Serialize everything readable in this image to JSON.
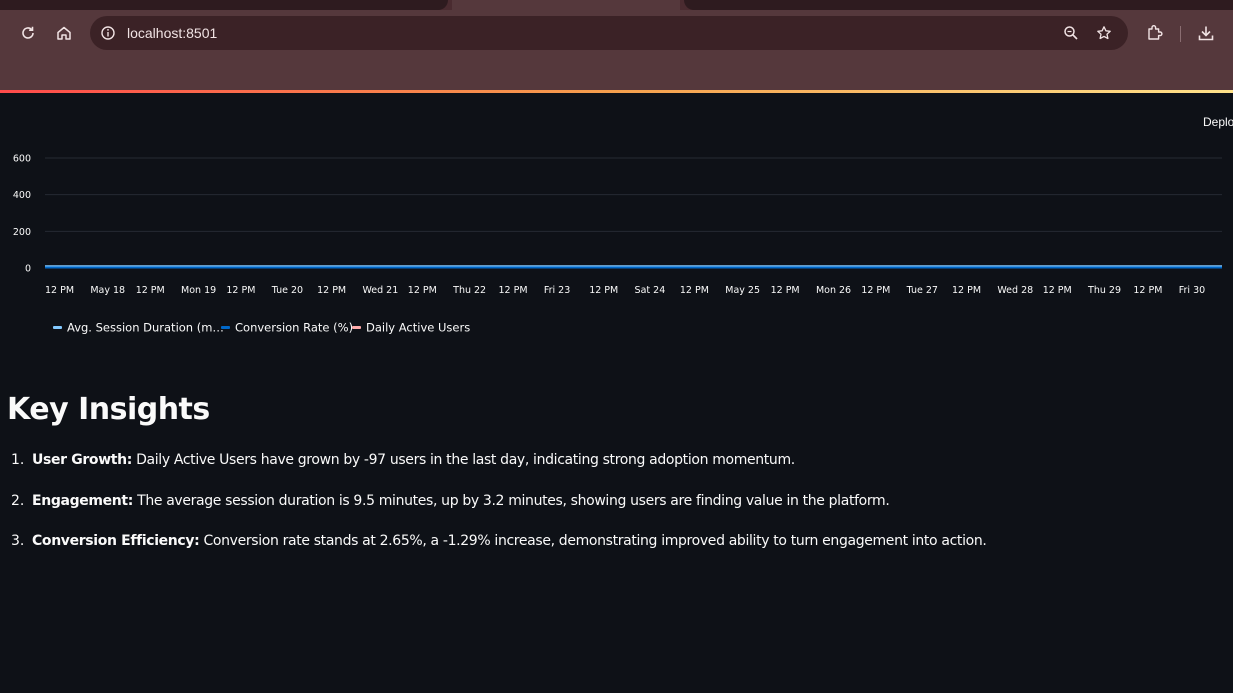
{
  "browser": {
    "url": "localhost:8501",
    "icons": [
      "reload-icon",
      "home-icon",
      "site-info-icon",
      "zoom-icon",
      "star-icon",
      "extensions-icon",
      "downloads-icon"
    ]
  },
  "app": {
    "deploy_label": "Deplo",
    "heading": "Key Insights",
    "accent_gradient": [
      "#ff4b4b",
      "#f6a04d",
      "#ffe28a"
    ]
  },
  "chart_data": {
    "type": "line",
    "yticks": [
      "600",
      "400",
      "200",
      "0"
    ],
    "ylim": [
      0,
      650
    ],
    "xticks": [
      "12 PM",
      "May 18",
      "12 PM",
      "Mon 19",
      "12 PM",
      "Tue 20",
      "12 PM",
      "Wed 21",
      "12 PM",
      "Thu 22",
      "12 PM",
      "Fri 23",
      "12 PM",
      "Sat 24",
      "12 PM",
      "May 25",
      "12 PM",
      "Mon 26",
      "12 PM",
      "Tue 27",
      "12 PM",
      "Wed 28",
      "12 PM",
      "Thu 29",
      "12 PM",
      "Fri 30"
    ],
    "grid": true,
    "legend_position": "bottom-left",
    "series": [
      {
        "name": "Avg. Session Duration (m…",
        "color": "#83c9ff",
        "values": [
          9,
          9,
          9,
          9,
          9,
          9,
          9,
          9,
          9,
          9,
          9,
          9,
          9,
          9,
          9,
          9,
          9,
          9,
          9,
          9,
          9,
          9,
          9,
          9,
          9,
          9
        ]
      },
      {
        "name": "Conversion Rate (%)",
        "color": "#0068c9",
        "values": [
          3,
          3,
          3,
          3,
          3,
          3,
          3,
          3,
          3,
          3,
          3,
          3,
          3,
          3,
          3,
          3,
          3,
          3,
          3,
          3,
          3,
          3,
          3,
          3,
          3,
          3
        ]
      },
      {
        "name": "Daily Active Users",
        "color": "#ffabab",
        "values": []
      }
    ]
  },
  "insights": [
    {
      "num": "1.",
      "label": "User Growth:",
      "text": " Daily Active Users have grown by -97 users in the last day, indicating strong adoption momentum."
    },
    {
      "num": "2.",
      "label": "Engagement:",
      "text": " The average session duration is 9.5 minutes, up by 3.2 minutes, showing users are finding value in the platform."
    },
    {
      "num": "3.",
      "label": "Conversion Efficiency:",
      "text": " Conversion rate stands at 2.65%, a -1.29% increase, demonstrating improved ability to turn engagement into action."
    }
  ]
}
